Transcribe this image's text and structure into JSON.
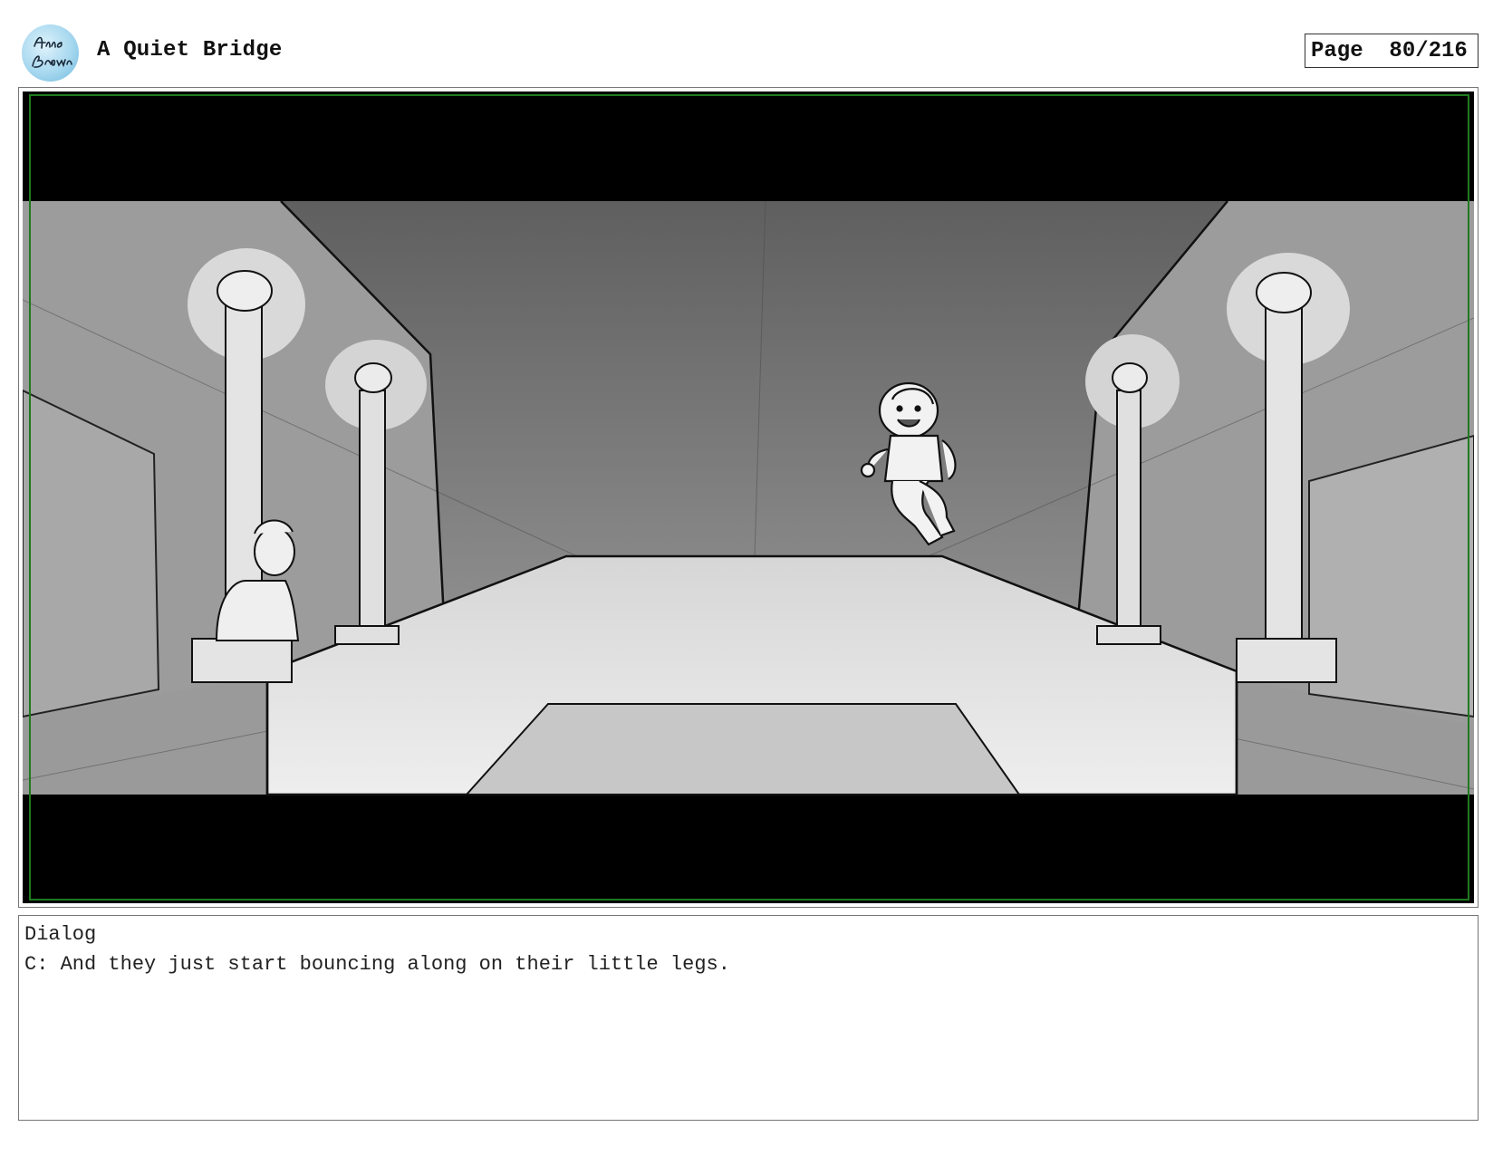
{
  "header": {
    "logo": {
      "icon": "artist-signature-logo",
      "signature_text": "Anna Brown"
    },
    "title": "A Quiet Bridge",
    "page_label": "Page",
    "page_number": "80/216"
  },
  "panel": {
    "frame_border_color": "#1f7a1f",
    "letterbox_color": "#000000"
  },
  "dialog": {
    "label": "Dialog",
    "text": "C: And they just start bouncing along on their little legs."
  }
}
